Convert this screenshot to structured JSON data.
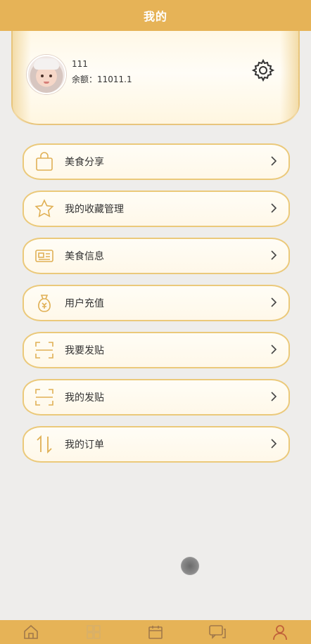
{
  "header": {
    "title": "我的"
  },
  "profile": {
    "username": "111",
    "balance_text": "余额：11011.1"
  },
  "menu": {
    "items": [
      {
        "label": "美食分享",
        "icon": "bag-icon"
      },
      {
        "label": "我的收藏管理",
        "icon": "star-icon"
      },
      {
        "label": "美食信息",
        "icon": "card-icon"
      },
      {
        "label": "用户充值",
        "icon": "moneybag-icon"
      },
      {
        "label": "我要发贴",
        "icon": "scan-frame-icon"
      },
      {
        "label": "我的发贴",
        "icon": "scan-frame-icon"
      },
      {
        "label": "我的订单",
        "icon": "sort-arrows-icon"
      }
    ]
  },
  "colors": {
    "accent": "#e6b357",
    "card_border": "#ebc97a",
    "icon_stroke": "#e0b055"
  },
  "tabbar": {
    "tabs": [
      {
        "icon": "home-icon"
      },
      {
        "icon": "grid-icon"
      },
      {
        "icon": "calendar-icon"
      },
      {
        "icon": "chat-icon"
      },
      {
        "icon": "user-icon"
      }
    ]
  }
}
